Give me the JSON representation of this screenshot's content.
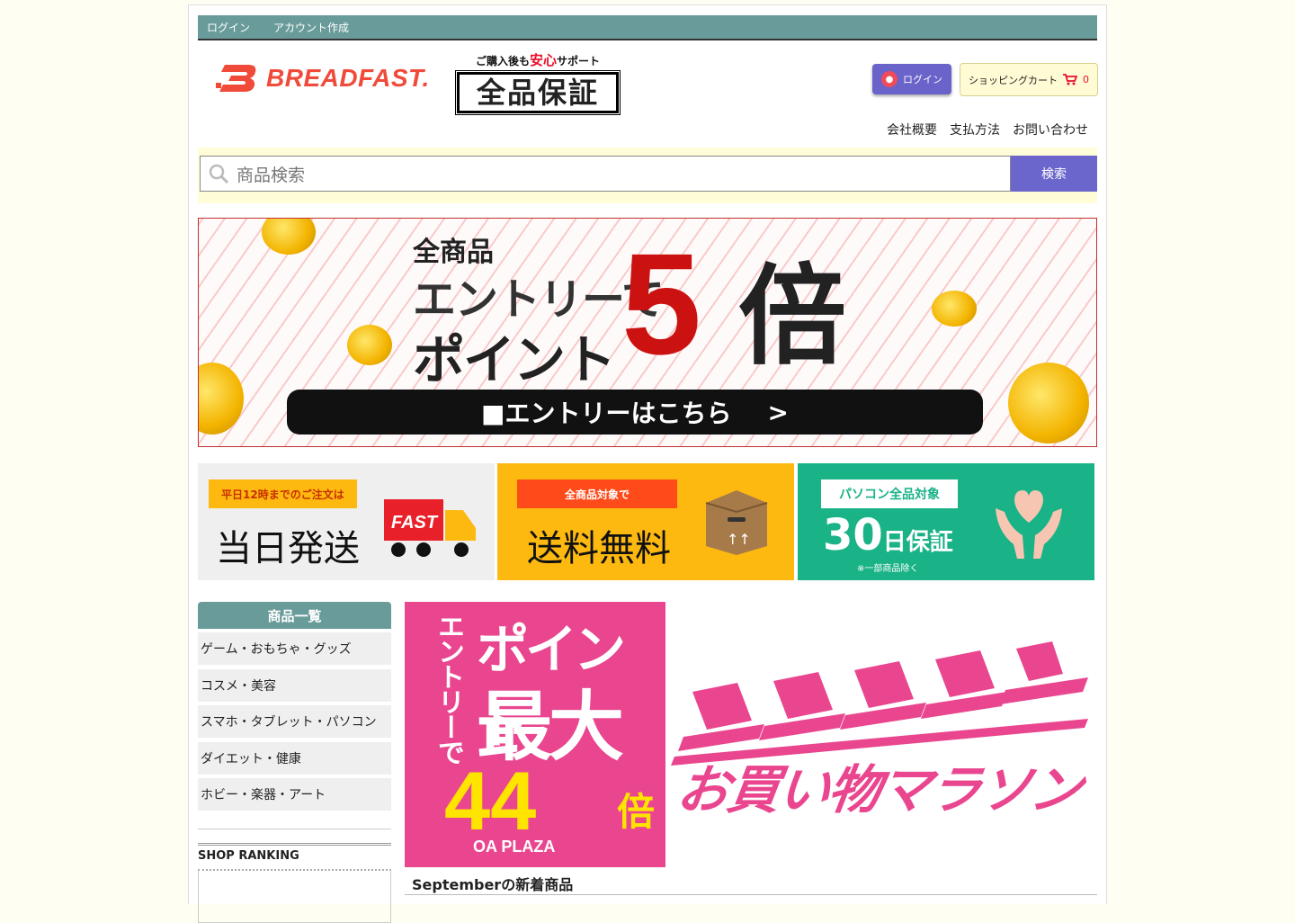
{
  "topbar": {
    "login": "ログイン",
    "signup": "アカウント作成"
  },
  "logo": {
    "text": "BREADFAST."
  },
  "guarantee": {
    "support_pre": "ご購入後も",
    "support_em": "安心",
    "support_post": "サポート",
    "badge": "全品保証"
  },
  "header": {
    "login_button": "ログイン",
    "cart_label": "ショッピングカート",
    "cart_count": "0"
  },
  "subnav": [
    "会社概要",
    "支払方法",
    "お問い合わせ"
  ],
  "search": {
    "placeholder": "商品検索",
    "button": "検索"
  },
  "hero": {
    "line1": "全商品",
    "line2": "エントリーで",
    "line3": "ポイント",
    "number": "5",
    "suffix": "倍",
    "cta": "■エントリーはこちら",
    "cta_arrow": ">"
  },
  "features": [
    {
      "tag": "平日12時までのご注文は",
      "main": "当日発送",
      "icon_text": "FAST"
    },
    {
      "tag": "全商品対象で",
      "main": "送料無料"
    },
    {
      "tag": "パソコン全品対象",
      "main_num": "30",
      "main_text": "日保証",
      "note": "※一部商品除く"
    }
  ],
  "sidebar": {
    "heading": "商品一覧",
    "items": [
      "ゲーム・おもちゃ・グッズ",
      "コスメ・美容",
      "スマホ・タブレット・パソコン",
      "ダイエット・健康",
      "ホビー・楽器・アート"
    ],
    "ranking": "SHOP RANKING"
  },
  "promo": {
    "vertical": "エントリーで",
    "point": "ポイント",
    "max": "最大",
    "number": "44",
    "suffix": "倍",
    "brand": "OA PLAZA",
    "marathon": "お買い物マラソン"
  },
  "news": {
    "title": "Septemberの新着商品"
  },
  "colors": {
    "teal": "#6a9b9b",
    "purple": "#6a66cc",
    "red": "#e8102a",
    "pink": "#e9468f",
    "green": "#1ab287",
    "orange": "#fdb910"
  }
}
